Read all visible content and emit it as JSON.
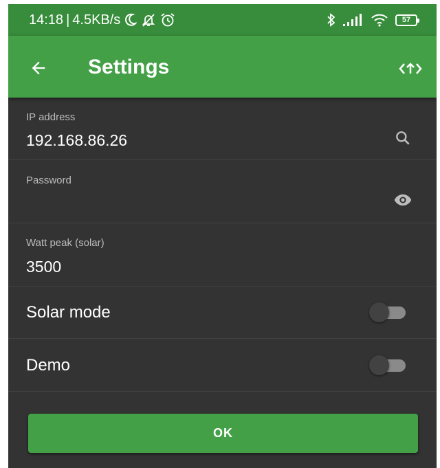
{
  "statusbar": {
    "time": "14:18",
    "separator": "|",
    "speed": "4.5KB/s",
    "icons": [
      "moon-icon",
      "mute-icon",
      "alarm-icon",
      "bluetooth-icon",
      "signal-icon",
      "wifi-icon",
      "battery-icon"
    ],
    "battery_level": "57"
  },
  "appbar": {
    "title": "Settings",
    "back_icon": "arrow-left-icon",
    "action_icon": "code-arrows-icon"
  },
  "fields": {
    "ip": {
      "label": "IP address",
      "value": "192.168.86.26",
      "icon": "search-icon"
    },
    "password": {
      "label": "Password",
      "value": "",
      "icon": "eye-icon"
    },
    "watt": {
      "label": "Watt peak (solar)",
      "value": "3500"
    }
  },
  "switches": {
    "solar": {
      "label": "Solar mode",
      "on": false
    },
    "demo": {
      "label": "Demo",
      "on": false
    }
  },
  "ok_label": "OK",
  "colors": {
    "statusbar": "#378d3b",
    "appbar": "#43a047",
    "background": "#333333",
    "button": "#43a047"
  }
}
